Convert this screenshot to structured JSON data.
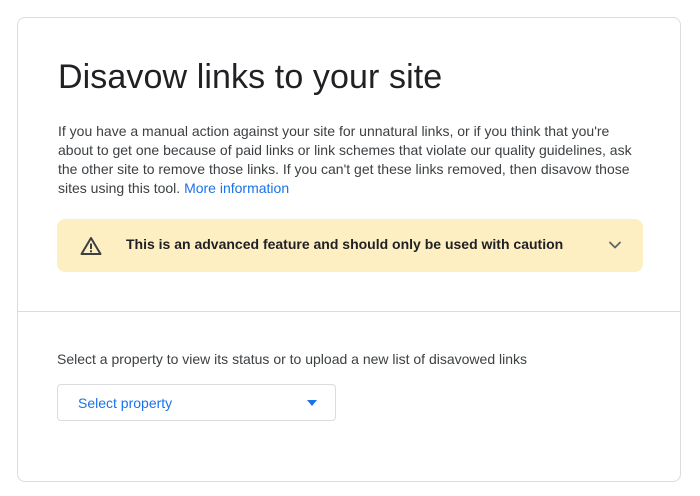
{
  "header": {
    "title": "Disavow links to your site"
  },
  "intro": {
    "text": "If you have a manual action against your site for unnatural links, or if you think that you're about to get one because of paid links or link schemes that violate our quality guidelines, ask the other site to remove those links. If you can't get these links removed, then disavow those sites using this tool.",
    "link_label": "More information"
  },
  "warning": {
    "icon": "warning-triangle-icon",
    "text": "This is an advanced feature and should only be used with caution",
    "expand_icon": "chevron-down-icon",
    "background": "#feefc3"
  },
  "property": {
    "prompt": "Select a property to view its status or to upload a new list of disavowed links",
    "select_label": "Select property",
    "caret_icon": "caret-down-icon"
  },
  "colors": {
    "accent": "#1a73e8",
    "text": "#202124",
    "border": "#dadce0"
  }
}
